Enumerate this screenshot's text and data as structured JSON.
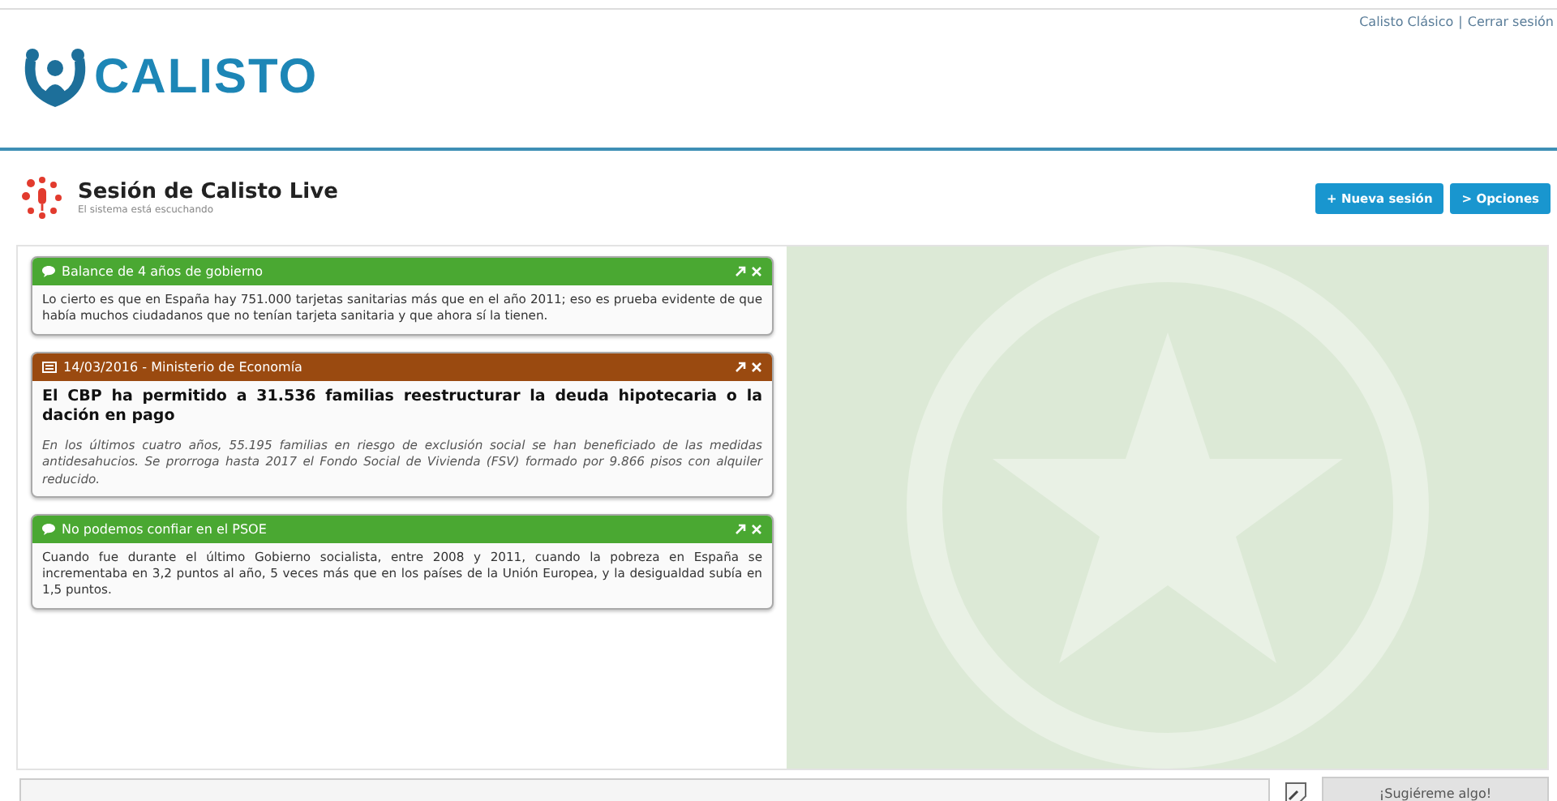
{
  "header": {
    "logo": "CALISTO",
    "links": [
      "Calisto Clásico",
      "Cerrar sesión"
    ],
    "separator": "|"
  },
  "session": {
    "title": "Sesión de Calisto Live",
    "status": "El sistema está escuchando",
    "buttons": [
      "+ Nueva sesión",
      "> Opciones"
    ]
  },
  "cards": [
    {
      "kind": "comment",
      "color": "#4aa832",
      "title": "Balance de 4 años de gobierno",
      "text": "Lo cierto es que en España hay 751.000 tarjetas sanitarias más que en el año 2011; eso es prueba evidente de que había muchos ciudadanos que no tenían tarjeta sanitaria y que ahora sí la tienen."
    },
    {
      "kind": "news",
      "color": "#9a4a10",
      "title": "14/03/2016 - Ministerio de Economía",
      "headline": "El CBP ha permitido a 31.536 familias reestructurar la deuda hipotecaria o la dación en pago",
      "text": "En los últimos cuatro años, 55.195 familias en riesgo de exclusión social se han beneficiado de las medidas antidesahucios. Se prorroga hasta 2017 el Fondo Social de Vivienda (FSV) formado por 9.866 pisos con alquiler reducido."
    },
    {
      "kind": "comment",
      "color": "#4aa832",
      "title": "No podemos confiar en el PSOE",
      "text": "Cuando fue durante el último Gobierno socialista, entre 2008 y 2011, cuando la pobreza en España se incrementaba en 3,2 puntos al año, 5 veces más que en los países de la Unión Europea, y la desigualdad subía en 1,5 puntos."
    }
  ],
  "footer": {
    "button": "¡Sugiéreme algo!"
  }
}
